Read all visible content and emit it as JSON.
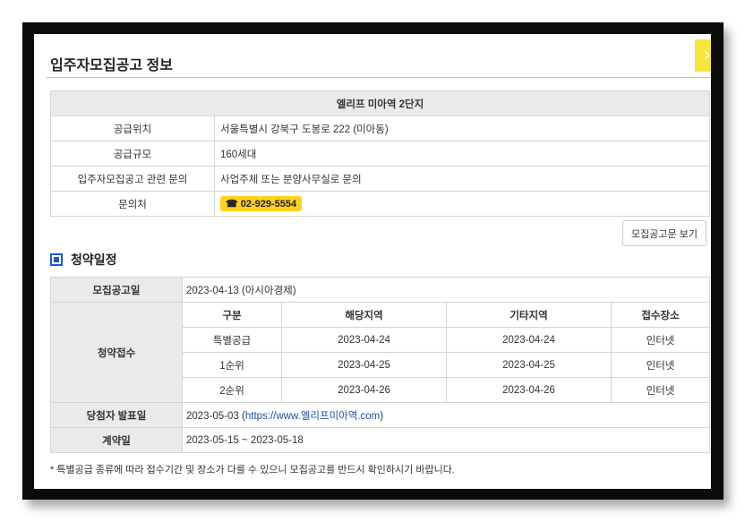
{
  "modal": {
    "title": "입주자모집공고 정보",
    "close_icon": "chevron-right-icon"
  },
  "info": {
    "complex_name": "엘리프 미아역 2단지",
    "rows": [
      {
        "label": "공급위치",
        "value": "서울특별시 강북구 도봉로 222 (미아동)"
      },
      {
        "label": "공급규모",
        "value": "160세대"
      },
      {
        "label": "입주자모집공고 관련 문의",
        "value": "사업주체 또는 분양사무실로 문의"
      },
      {
        "label": "문의처",
        "value": "☎ 02-929-5554"
      }
    ]
  },
  "notice_button": "모집공고문 보기",
  "schedule": {
    "title": "청약일정",
    "announcement": {
      "label": "모집공고일",
      "value": "2023-04-13 (아시아경제)"
    },
    "application": {
      "label": "청약접수",
      "headers": [
        "구분",
        "해당지역",
        "기타지역",
        "접수장소"
      ],
      "rows": [
        [
          "특별공급",
          "2023-04-24",
          "2023-04-24",
          "인터넷"
        ],
        [
          "1순위",
          "2023-04-25",
          "2023-04-25",
          "인터넷"
        ],
        [
          "2순위",
          "2023-04-26",
          "2023-04-26",
          "인터넷"
        ]
      ]
    },
    "winner": {
      "label": "당첨자 발표일",
      "prefix": "2023-05-03 (",
      "link": "https://www.엘리프미아역.com",
      "suffix": ")"
    },
    "contract": {
      "label": "계약일",
      "value": "2023-05-15 ~ 2023-05-18"
    }
  },
  "footnote": "* 특별공급 종류에 따라 접수기간 및 장소가 다를 수 있으니 모집공고를 반드시 확인하시기 바랍니다.",
  "colors": {
    "accent": "#1e5bc6",
    "badge": "#ffd21e",
    "close": "#f6e63a"
  }
}
